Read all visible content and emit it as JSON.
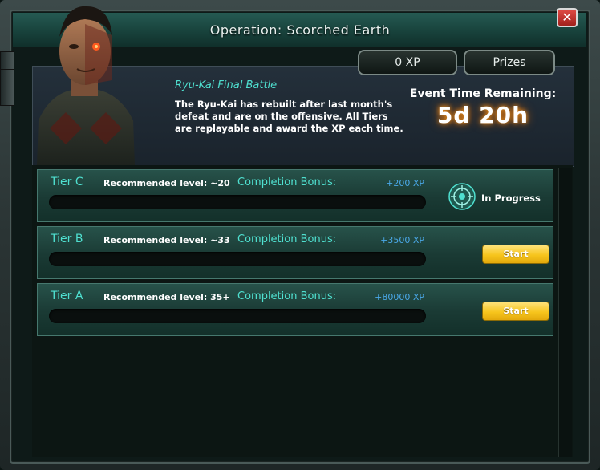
{
  "header": {
    "title": "Operation: Scorched Earth",
    "close_label": "✕"
  },
  "top_buttons": {
    "xp_label": "0 XP",
    "prizes_label": "Prizes"
  },
  "event": {
    "name": "Ryu-Kai Final Battle",
    "description": "The Ryu-Kai has rebuilt after last month's defeat and are on the offensive. All Tiers are replayable and award the XP each time.",
    "timer_label": "Event Time Remaining:",
    "timer_value": "5d 20h"
  },
  "tiers": [
    {
      "name": "Tier C",
      "recommended": "Recommended level: ~20",
      "bonus_label": "Completion Bonus:",
      "bonus_value": "+200 XP",
      "status": "In Progress"
    },
    {
      "name": "Tier B",
      "recommended": "Recommended level: ~33",
      "bonus_label": "Completion Bonus:",
      "bonus_value": "+3500 XP",
      "button_label": "Start"
    },
    {
      "name": "Tier A",
      "recommended": "Recommended level: 35+",
      "bonus_label": "Completion Bonus:",
      "bonus_value": "+80000 XP",
      "button_label": "Start"
    }
  ],
  "colors": {
    "accent_teal": "#4fe0d0",
    "bonus_blue": "#4aa8e8",
    "button_gold": "#f7c51d",
    "close_red": "#c8312b"
  }
}
